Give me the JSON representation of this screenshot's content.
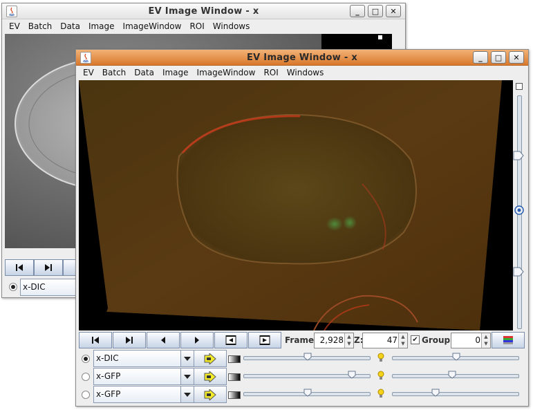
{
  "back_window": {
    "title": "EV Image Window - x",
    "menu": [
      "EV",
      "Batch",
      "Data",
      "Image",
      "ImageWindow",
      "ROI",
      "Windows"
    ],
    "channel": "x-DIC"
  },
  "front_window": {
    "title": "EV Image Window - x",
    "menu": [
      "EV",
      "Batch",
      "Data",
      "Image",
      "ImageWindow",
      "ROI",
      "Windows"
    ],
    "frame_label": "Frame:",
    "frame_value": "2,928",
    "z_label": "Z:",
    "z_value": "47",
    "group_checked": true,
    "group_label": "Group:",
    "group_value": "0",
    "channels": [
      {
        "name": "x-DIC",
        "selected": true
      },
      {
        "name": "x-GFP",
        "selected": false
      },
      {
        "name": "x-GFP",
        "selected": false
      }
    ]
  },
  "colors": {
    "front_title_bar": "#e08a3c",
    "image_tint": "#5a3a10",
    "nav_button": "#c7d3e6",
    "adjust_icon": "#f2ea2a"
  }
}
